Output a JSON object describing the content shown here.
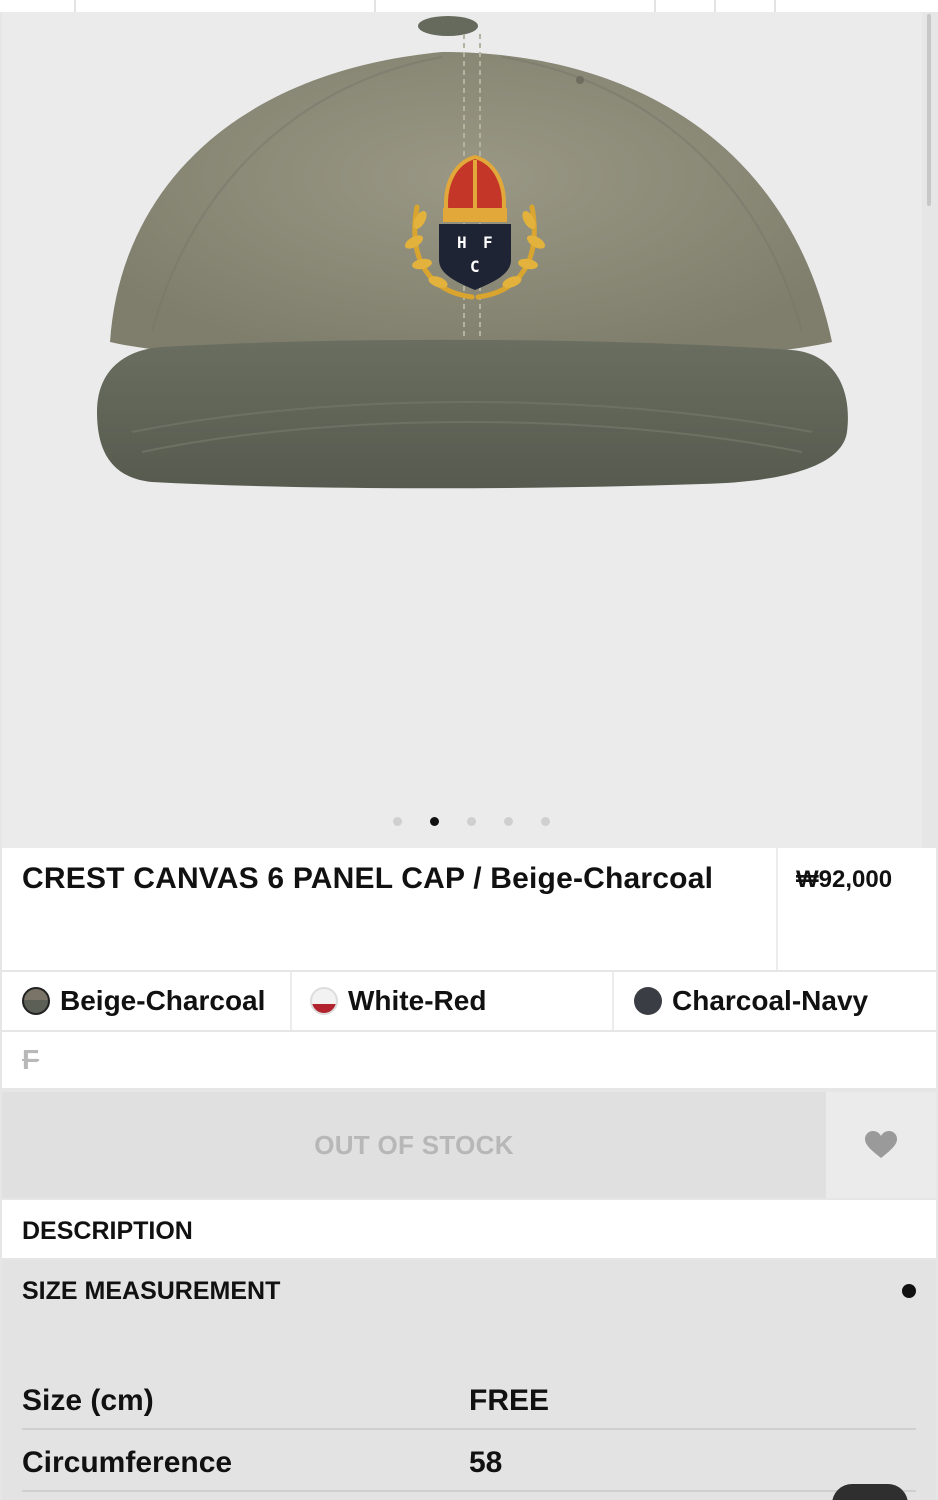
{
  "product": {
    "title": "CREST CANVAS 6 PANEL CAP / Beige-Charcoal",
    "price": "₩92,000",
    "image_alt": "hat-image",
    "crest_letters": [
      "H",
      "F",
      "C"
    ],
    "gallery": {
      "slide_count": 5,
      "active_index": 1
    }
  },
  "colors": [
    {
      "label": "Beige-Charcoal",
      "swatch": "beige-charcoal-swatch"
    },
    {
      "label": "White-Red",
      "swatch": "white-red-swatch"
    },
    {
      "label": "Charcoal-Navy",
      "swatch": "charcoal-navy-swatch"
    }
  ],
  "size": {
    "label": "F",
    "sold_out": true
  },
  "actions": {
    "status_label": "OUT OF STOCK",
    "wishlist_icon": "heart-icon"
  },
  "sections": {
    "description_label": "DESCRIPTION",
    "size_measurement_label": "SIZE MEASUREMENT"
  },
  "measurements": [
    {
      "label": "Size (cm)",
      "value": "FREE"
    },
    {
      "label": "Circumference",
      "value": "58"
    }
  ],
  "theme": {
    "background": "#ebebeb",
    "text": "#111111",
    "muted": "#b7b7b7",
    "cap_crown": "#8b8a78",
    "cap_brim": "#5f6356"
  }
}
